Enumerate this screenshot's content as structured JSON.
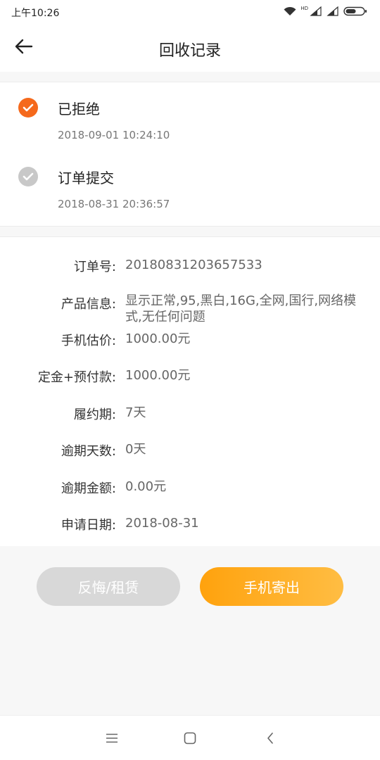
{
  "status_bar": {
    "time": "上午10:26",
    "network_label": "HD",
    "icons": [
      "wifi-icon",
      "signal-icon",
      "signal-icon",
      "battery-icon"
    ]
  },
  "header": {
    "title": "回收记录",
    "back_icon": "arrow-left-icon"
  },
  "timeline": [
    {
      "title": "已拒绝",
      "time": "2018-09-01 10:24:10",
      "state": "active",
      "color": "#f5691c"
    },
    {
      "title": "订单提交",
      "time": "2018-08-31 20:36:57",
      "state": "inactive",
      "color": "#c8c8c8"
    }
  ],
  "details": [
    {
      "label": "订单号:",
      "value": "20180831203657533"
    },
    {
      "label": "产品信息:",
      "value": "显示正常,95,黑白,16G,全网,国行,网络模式,无任何问题"
    },
    {
      "label": "手机估价:",
      "value": "1000.00元"
    },
    {
      "label": "定金+预付款:",
      "value": "1000.00元"
    },
    {
      "label": "履约期:",
      "value": "7天"
    },
    {
      "label": "逾期天数:",
      "value": "0天"
    },
    {
      "label": "逾期金额:",
      "value": "0.00元"
    },
    {
      "label": "申请日期:",
      "value": "2018-08-31"
    }
  ],
  "actions": {
    "regret_label": "反悔/租赁",
    "ship_label": "手机寄出",
    "regret_color": "#d8d8d8",
    "ship_color": "#ffa20d"
  },
  "nav_bar": {
    "icons": [
      "menu-icon",
      "home-square-icon",
      "back-chevron-icon"
    ]
  }
}
